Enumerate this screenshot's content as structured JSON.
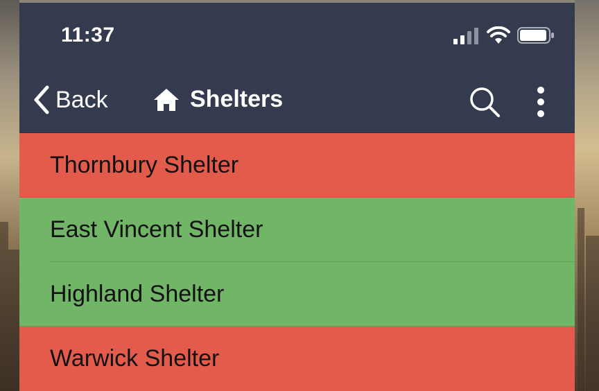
{
  "status_bar": {
    "time": "11:37",
    "signal_icon": "cellular-signal-icon",
    "wifi_icon": "wifi-icon",
    "battery_icon": "battery-icon"
  },
  "nav": {
    "back_label": "Back",
    "title": "Shelters",
    "home_icon": "home-icon",
    "search_icon": "search-icon",
    "more_icon": "more-vertical-icon",
    "bar_color": "#343b4f"
  },
  "shelters": [
    {
      "name": "Thornbury Shelter",
      "status_color": "#e35c4b"
    },
    {
      "name": "East Vincent Shelter",
      "status_color": "#71b567"
    },
    {
      "name": "Highland Shelter",
      "status_color": "#71b567"
    },
    {
      "name": "Warwick Shelter",
      "status_color": "#e35c4b"
    }
  ]
}
